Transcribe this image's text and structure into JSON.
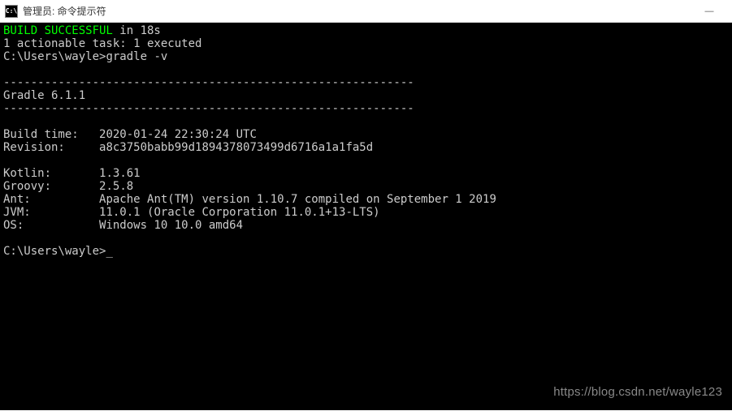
{
  "titlebar": {
    "icon_text": "C:\\",
    "title": "管理员: 命令提示符",
    "minimize": "—"
  },
  "terminal": {
    "build_success": "BUILD SUCCESSFUL",
    "build_time_suffix": " in 18s",
    "actionable": "1 actionable task: 1 executed",
    "prompt1_path": "C:\\Users\\wayle>",
    "prompt1_cmd": "gradle -v",
    "sep": "------------------------------------------------------------",
    "gradle_ver": "Gradle 6.1.1",
    "build_time_label": "Build time:",
    "build_time_value": "2020-01-24 22:30:24 UTC",
    "revision_label": "Revision:",
    "revision_value": "a8c3750babb99d1894378073499d6716a1a1fa5d",
    "kotlin_label": "Kotlin:",
    "kotlin_value": "1.3.61",
    "groovy_label": "Groovy:",
    "groovy_value": "2.5.8",
    "ant_label": "Ant:",
    "ant_value": "Apache Ant(TM) version 1.10.7 compiled on September 1 2019",
    "jvm_label": "JVM:",
    "jvm_value": "11.0.1 (Oracle Corporation 11.0.1+13-LTS)",
    "os_label": "OS:",
    "os_value": "Windows 10 10.0 amd64",
    "prompt2_path": "C:\\Users\\wayle>",
    "cursor": "_"
  },
  "watermark": "https://blog.csdn.net/wayle123"
}
